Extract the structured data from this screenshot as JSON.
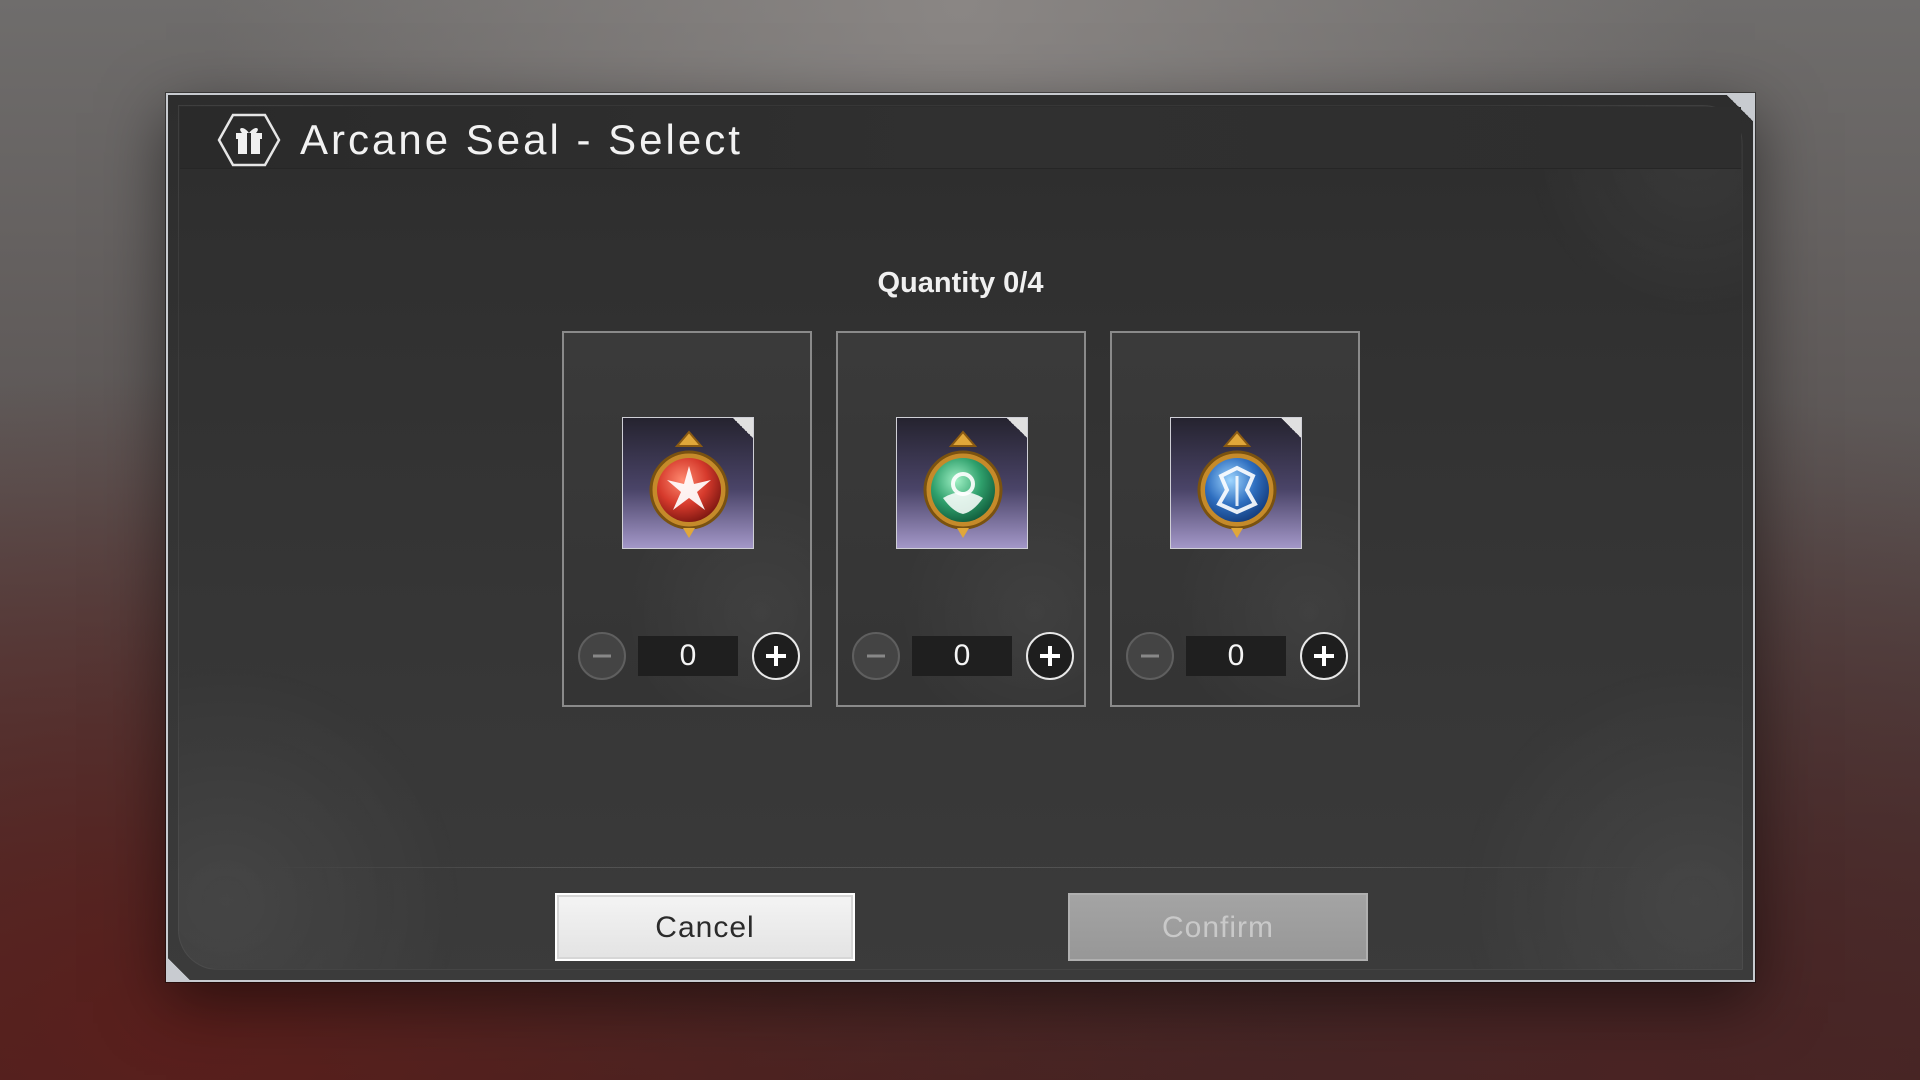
{
  "dialog": {
    "title": "Arcane Seal - Select",
    "title_icon": "gift-box-icon",
    "quantity_label": "Quantity 0/4",
    "selected_count": 0,
    "max_count": 4
  },
  "items": [
    {
      "name": "red-arcane-seal",
      "color": "#c8322c",
      "icon": "red-seal-gem-icon",
      "count": "0"
    },
    {
      "name": "green-arcane-seal",
      "color": "#2f9a6a",
      "icon": "green-seal-gem-icon",
      "count": "0"
    },
    {
      "name": "blue-arcane-seal",
      "color": "#2f6fc0",
      "icon": "blue-seal-gem-icon",
      "count": "0"
    }
  ],
  "buttons": {
    "cancel_label": "Cancel",
    "confirm_label": "Confirm",
    "confirm_enabled": false
  },
  "colors": {
    "frame": "#c8cbd0",
    "panel": "#333333",
    "slot_gradient_bottom": "#a397c8"
  }
}
